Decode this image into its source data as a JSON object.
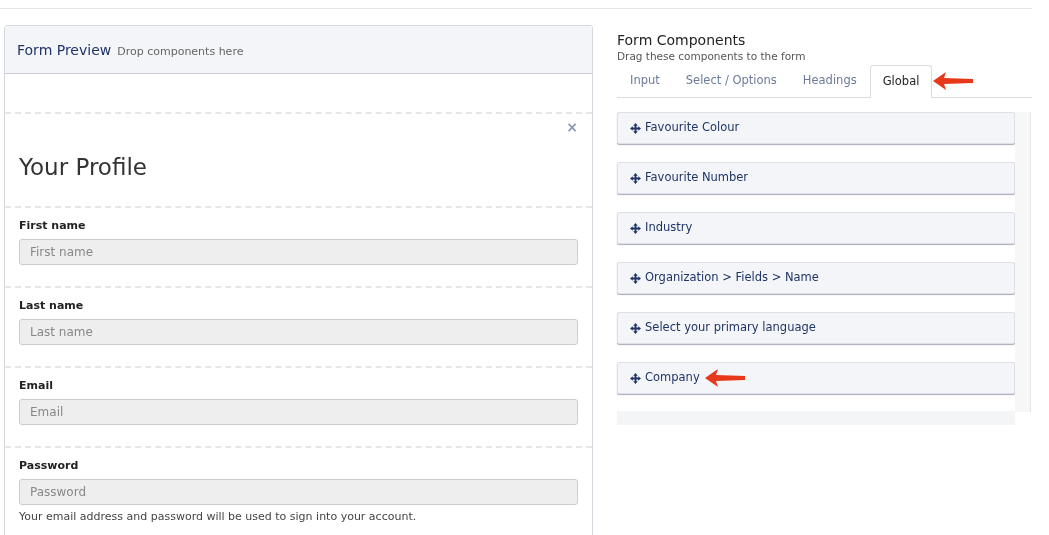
{
  "preview": {
    "title": "Form Preview",
    "subtitle": "Drop components here",
    "close": "×",
    "heading": "Your Profile",
    "fields": [
      {
        "label": "First name",
        "placeholder": "First name"
      },
      {
        "label": "Last name",
        "placeholder": "Last name"
      },
      {
        "label": "Email",
        "placeholder": "Email"
      },
      {
        "label": "Password",
        "placeholder": "Password",
        "help": "Your email address and password will be used to sign into your account."
      }
    ]
  },
  "components": {
    "title": "Form Components",
    "subtitle": "Drag these components to the form",
    "tabs": [
      {
        "label": "Input",
        "selected": false,
        "marked": false
      },
      {
        "label": "Select / Options",
        "selected": false,
        "marked": false
      },
      {
        "label": "Headings",
        "selected": false,
        "marked": false
      },
      {
        "label": "Global",
        "selected": true,
        "marked": true
      }
    ],
    "items": [
      {
        "label": "Favourite Colour",
        "marked": false
      },
      {
        "label": "Favourite Number",
        "marked": false
      },
      {
        "label": "Industry",
        "marked": false
      },
      {
        "label": "Organization > Fields > Name",
        "marked": false
      },
      {
        "label": "Select your primary language",
        "marked": false
      },
      {
        "label": "Company",
        "marked": true
      }
    ]
  }
}
